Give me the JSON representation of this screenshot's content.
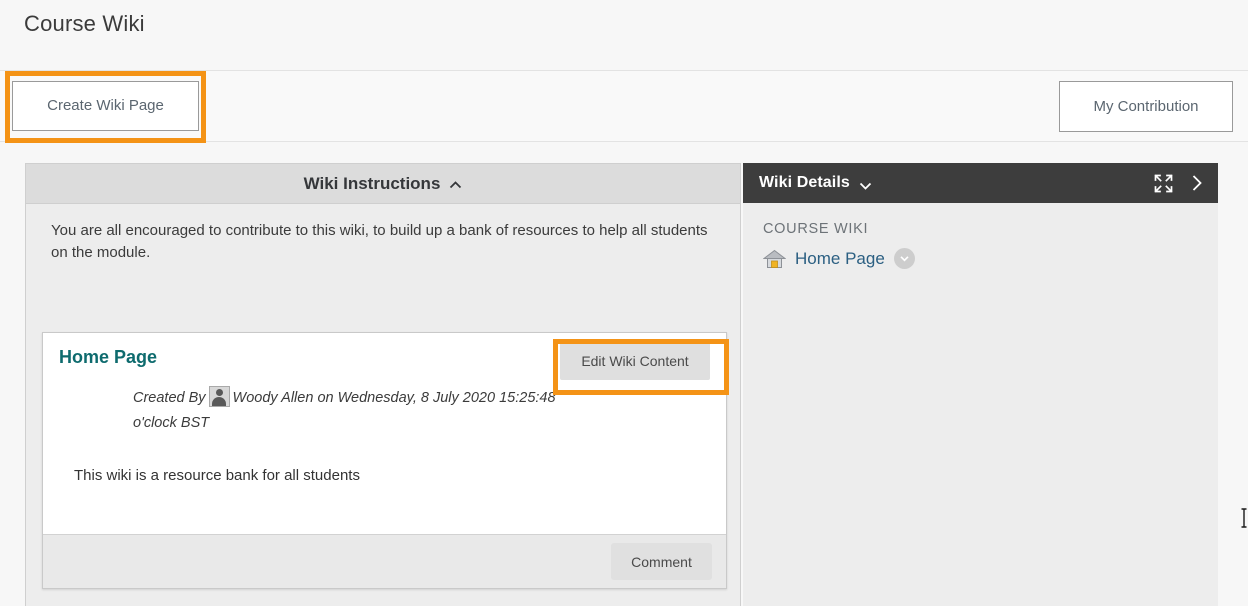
{
  "page": {
    "title": "Course Wiki"
  },
  "action_bar": {
    "create_button": "Create Wiki Page",
    "my_contribution_button": "My Contribution"
  },
  "instructions_panel": {
    "title": "Wiki Instructions",
    "toggle_icon": "chevron-up-icon",
    "body_text": "You are all encouraged to contribute to this wiki, to build up a bank of resources to help all students on the module."
  },
  "wiki_card": {
    "page_title": "Home Page",
    "edit_button": "Edit Wiki Content",
    "created_by_prefix": "Created By",
    "author": "Woody Allen",
    "created_on": "on Wednesday, 8 July 2020 15:25:48 o'clock BST",
    "content_text": "This wiki is a resource bank for all students",
    "comment_button": "Comment",
    "avatar_icon": "user-avatar-icon"
  },
  "details_panel": {
    "title": "Wiki Details",
    "toggle_icon": "chevron-down-icon",
    "expand_icon": "expand-fullscreen-icon",
    "collapse_icon": "chevron-right-icon",
    "breadcrumb": "COURSE WIKI",
    "home_page_label": "Home Page",
    "home_icon": "home-icon",
    "home_menu_icon": "circle-chevron-down-icon"
  },
  "colors": {
    "highlight": "#f49316",
    "panel_header_dark": "#3d3d3d",
    "wiki_title_teal": "#0e6b6e",
    "link_blue": "#2b5f82"
  },
  "cursor": {
    "type": "text-cursor"
  }
}
